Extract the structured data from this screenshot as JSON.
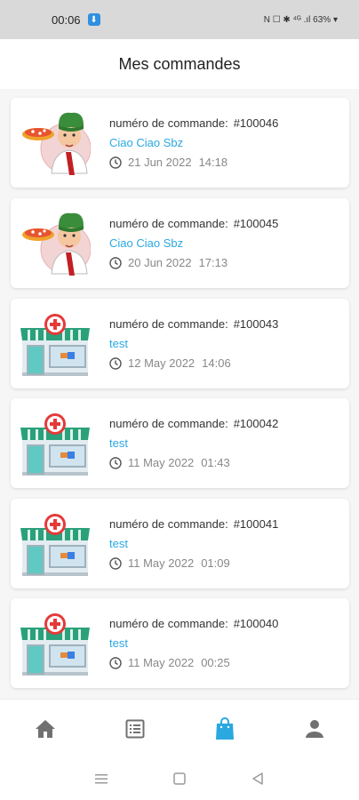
{
  "status_bar": {
    "time": "00:06",
    "right_text": "N ☐ ✱ ⁴ᴳ .ıl 63% ▾"
  },
  "header": {
    "title": "Mes commandes"
  },
  "orders": [
    {
      "label": "numéro de commande:",
      "number": "#100046",
      "store": "Ciao Ciao Sbz",
      "date": "21 Jun 2022",
      "time": "14:18",
      "thumb": "pizza-chef"
    },
    {
      "label": "numéro de commande:",
      "number": "#100045",
      "store": "Ciao Ciao Sbz",
      "date": "20 Jun 2022",
      "time": "17:13",
      "thumb": "pizza-chef"
    },
    {
      "label": "numéro de commande:",
      "number": "#100043",
      "store": "test",
      "date": "12 May 2022",
      "time": "14:06",
      "thumb": "pharmacy"
    },
    {
      "label": "numéro de commande:",
      "number": "#100042",
      "store": "test",
      "date": "11 May 2022",
      "time": "01:43",
      "thumb": "pharmacy"
    },
    {
      "label": "numéro de commande:",
      "number": "#100041",
      "store": "test",
      "date": "11 May 2022",
      "time": "01:09",
      "thumb": "pharmacy"
    },
    {
      "label": "numéro de commande:",
      "number": "#100040",
      "store": "test",
      "date": "11 May 2022",
      "time": "00:25",
      "thumb": "pharmacy"
    }
  ],
  "bottom_nav": [
    {
      "icon": "home-icon",
      "active": false
    },
    {
      "icon": "list-icon",
      "active": false
    },
    {
      "icon": "shopping-bag-icon",
      "active": true
    },
    {
      "icon": "user-icon",
      "active": false
    }
  ],
  "colors": {
    "accent": "#2aa8e0",
    "inactive_icon": "#707070",
    "store_text": "#2aa8e0"
  }
}
